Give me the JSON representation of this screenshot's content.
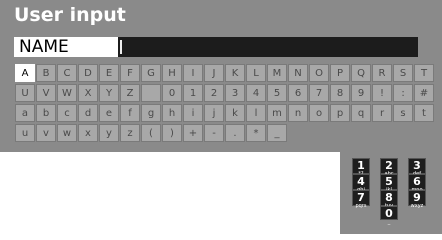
{
  "dialog": {
    "title": "User input",
    "field_label": "NAME",
    "field_value": ""
  },
  "keyboard": {
    "selected": "A",
    "rows": [
      [
        "A",
        "B",
        "C",
        "D",
        "E",
        "F",
        "G",
        "H",
        "I",
        "J",
        "K",
        "L",
        "M",
        "N",
        "O",
        "P",
        "Q",
        "R",
        "S",
        "T"
      ],
      [
        "U",
        "V",
        "W",
        "X",
        "Y",
        "Z",
        "",
        "0",
        "1",
        "2",
        "3",
        "4",
        "5",
        "6",
        "7",
        "8",
        "9",
        "!",
        ":",
        "#"
      ],
      [
        "a",
        "b",
        "c",
        "d",
        "e",
        "f",
        "g",
        "h",
        "i",
        "j",
        "k",
        "l",
        "m",
        "n",
        "o",
        "p",
        "q",
        "r",
        "s",
        "t"
      ],
      [
        "u",
        "v",
        "w",
        "x",
        "y",
        "z",
        "(",
        ")",
        "+",
        "-",
        ".",
        "*",
        "_"
      ]
    ]
  },
  "keypad": [
    {
      "digit": "1",
      "letters": "*?"
    },
    {
      "digit": "2",
      "letters": "abc"
    },
    {
      "digit": "3",
      "letters": "def"
    },
    {
      "digit": "4",
      "letters": "ghi"
    },
    {
      "digit": "5",
      "letters": "jkl"
    },
    {
      "digit": "6",
      "letters": "mno"
    },
    {
      "digit": "7",
      "letters": "pqrs"
    },
    {
      "digit": "8",
      "letters": "tuv"
    },
    {
      "digit": "9",
      "letters": "wxyz"
    },
    {
      "digit": "0",
      "letters": "_"
    }
  ]
}
